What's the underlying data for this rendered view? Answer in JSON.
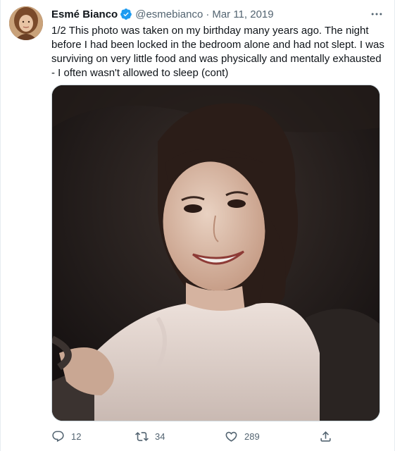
{
  "tweet": {
    "display_name": "Esmé Bianco",
    "handle": "@esmebianco",
    "separator": "·",
    "date": "Mar 11, 2019",
    "text": "1/2 This photo was taken on my birthday many years ago. The night before I had been locked in the bedroom alone and had not slept. I was surviving on very little food and was physically and mentally exhausted - I often wasn't allowed to sleep (cont)"
  },
  "actions": {
    "reply_count": "12",
    "retweet_count": "34",
    "like_count": "289"
  },
  "icons": {
    "verified": "verified-badge-icon",
    "more": "more-dots-icon",
    "reply": "reply-icon",
    "retweet": "retweet-icon",
    "like": "heart-icon",
    "share": "share-icon"
  },
  "colors": {
    "verified_blue": "#1d9bf0",
    "muted_text": "#536471",
    "text": "#0f1419"
  }
}
